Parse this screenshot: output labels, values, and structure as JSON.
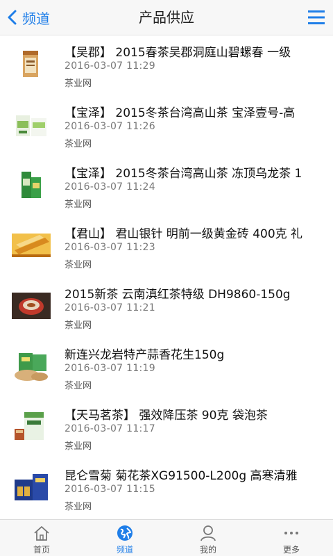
{
  "header": {
    "back_label": "频道",
    "title": "产品供应"
  },
  "colors": {
    "accent": "#1f7ee8"
  },
  "items": [
    {
      "title": "【吴郡】 2015春茶吴郡洞庭山碧螺春 一级",
      "time": "2016-03-07 11:29",
      "source": "茶业网"
    },
    {
      "title": "【宝泽】 2015冬茶台湾高山茶 宝泽壹号-高",
      "time": "2016-03-07 11:26",
      "source": "茶业网"
    },
    {
      "title": "【宝泽】 2015冬茶台湾高山茶 冻顶乌龙茶 1",
      "time": "2016-03-07 11:24",
      "source": "茶业网"
    },
    {
      "title": "【君山】 君山银针 明前一级黄金砖 400克 礼",
      "time": "2016-03-07 11:23",
      "source": "茶业网"
    },
    {
      "title": "2015新茶 云南滇红茶特级 DH9860-150g",
      "time": "2016-03-07 11:21",
      "source": "茶业网"
    },
    {
      "title": "新连兴龙岩特产蒜香花生150g",
      "time": "2016-03-07 11:19",
      "source": "茶业网"
    },
    {
      "title": "【天马茗茶】 强效降压茶 90克 袋泡茶",
      "time": "2016-03-07 11:17",
      "source": "茶业网"
    },
    {
      "title": "昆仑雪菊 菊花茶XG91500-L200g 高寒清雅",
      "time": "2016-03-07 11:15",
      "source": "茶业网"
    }
  ],
  "tabs": [
    {
      "label": "首页",
      "icon": "home-icon"
    },
    {
      "label": "频道",
      "icon": "globe-icon"
    },
    {
      "label": "我的",
      "icon": "user-icon"
    },
    {
      "label": "更多",
      "icon": "more-icon"
    }
  ]
}
